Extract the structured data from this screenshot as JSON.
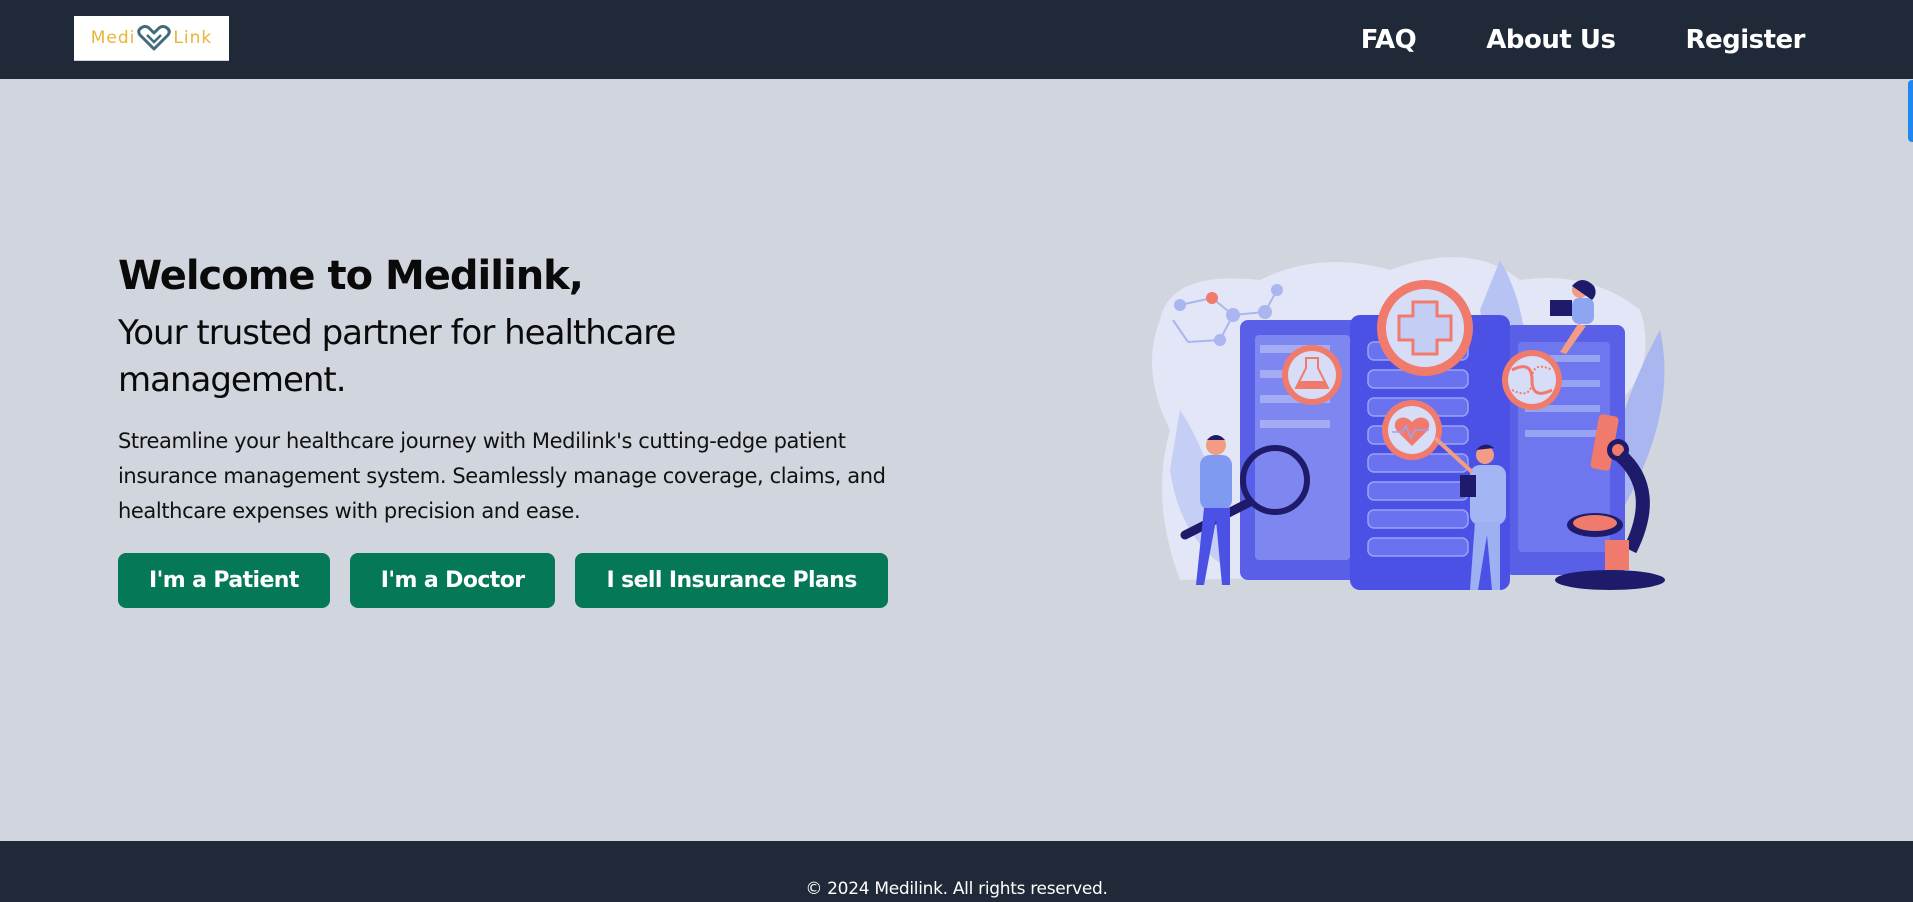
{
  "navbar": {
    "logo": {
      "left_text": "Medi",
      "right_text": "Link",
      "icon": "heart-check-icon",
      "text_color": "#e8b534",
      "icon_color": "#3f6b7a"
    },
    "links": [
      {
        "label": "FAQ"
      },
      {
        "label": "About Us"
      },
      {
        "label": "Register"
      }
    ],
    "background": "#1f2937"
  },
  "hero": {
    "title": "Welcome to Medilink,",
    "subtitle": "Your trusted partner for healthcare management.",
    "description": "Streamline your healthcare journey with Medilink's cutting-edge patient insurance management system. Seamlessly manage coverage, claims, and healthcare expenses with precision and ease.",
    "buttons": [
      {
        "label": "I'm a Patient"
      },
      {
        "label": "I'm a Doctor"
      },
      {
        "label": "I sell Insurance Plans"
      }
    ],
    "button_color": "#047857"
  },
  "illustration": {
    "description": "Healthcare data servers illustration with medical icons, doctors, magnifying glass and microscope",
    "icons": [
      "medical-cross-icon",
      "flask-icon",
      "dna-icon",
      "heartbeat-icon",
      "magnifying-glass-icon",
      "microscope-icon"
    ]
  },
  "footer": {
    "copyright": "© 2024 Medilink. All rights reserved."
  }
}
